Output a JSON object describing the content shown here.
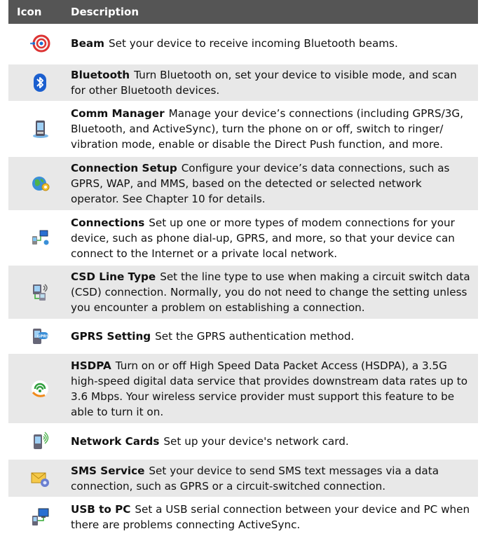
{
  "header": {
    "icon_col": "Icon",
    "desc_col": "Description"
  },
  "rows": [
    {
      "icon": "beam-icon",
      "name": "Beam",
      "desc": "Set your device to receive incoming Bluetooth beams."
    },
    {
      "icon": "bluetooth-icon",
      "name": "Bluetooth",
      "desc": "Turn Bluetooth on, set your device to visible mode, and scan for other Bluetooth devices."
    },
    {
      "icon": "comm-manager-icon",
      "name": "Comm Manager",
      "desc": "Manage your device’s connections (including GPRS/3G, Bluetooth, and ActiveSync), turn the phone on or off, switch to ringer/ vibration mode, enable or disable the Direct Push function, and more."
    },
    {
      "icon": "connection-setup-icon",
      "name": "Connection Setup",
      "desc": "Configure your device’s data connections, such as GPRS, WAP, and MMS, based on the detected or selected network operator. See Chapter 10 for details."
    },
    {
      "icon": "connections-icon",
      "name": "Connections",
      "desc": "Set up one or more types of modem connections for your device, such as phone dial-up, GPRS, and more, so that your device can connect to the Internet or a private local network."
    },
    {
      "icon": "csd-line-type-icon",
      "name": "CSD Line Type",
      "desc": "Set the line type to use when making a circuit switch data (CSD) connection. Normally, you do not need to change the setting unless you encounter a problem on establishing a connection."
    },
    {
      "icon": "gprs-setting-icon",
      "name": "GPRS Setting",
      "desc": "Set the GPRS authentication method."
    },
    {
      "icon": "hsdpa-icon",
      "name": "HSDPA",
      "desc": "Turn on or off High Speed Data Packet Access (HSDPA), a 3.5G high-speed digital data service that provides downstream data rates up to 3.6 Mbps. Your wireless service provider must support this feature to be able to turn it on."
    },
    {
      "icon": "network-cards-icon",
      "name": "Network Cards",
      "desc": "Set up your device's network card."
    },
    {
      "icon": "sms-service-icon",
      "name": "SMS Service",
      "desc": "Set your device to send SMS text messages via a data connection, such as GPRS or a circuit-switched connection."
    },
    {
      "icon": "usb-to-pc-icon",
      "name": "USB to PC",
      "desc": "Set a USB serial connection between your device and PC when there are problems connecting ActiveSync."
    }
  ]
}
